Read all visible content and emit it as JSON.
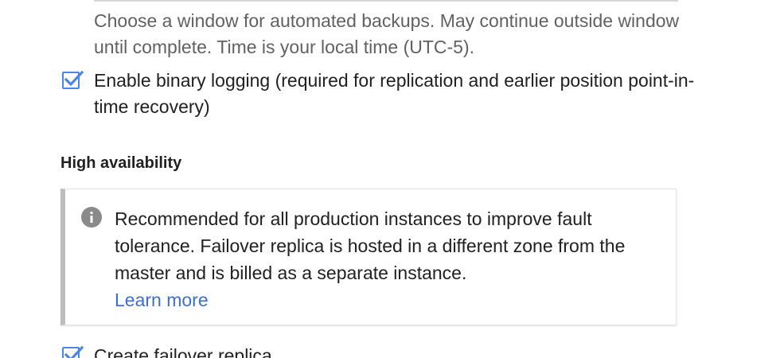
{
  "backup": {
    "window_hint": "Choose a window for automated backups. May continue outside window until complete. Time is your local time (UTC-5)."
  },
  "binary_logging": {
    "label": "Enable binary logging (required for replication and earlier position point-in-time recovery)",
    "checked": true
  },
  "high_availability": {
    "title": "High availability",
    "info_text": "Recommended for all production instances to improve fault tolerance. Failover replica is hosted in a different zone from the master and is billed as a separate instance.",
    "learn_more": "Learn more",
    "info_icon": "info-icon"
  },
  "failover": {
    "label": "Create failover replica",
    "checked": true
  },
  "colors": {
    "accent": "#4a86e8",
    "link": "#3b6fd4",
    "hint_text": "#616161",
    "info_border": "#bdbdbd"
  }
}
